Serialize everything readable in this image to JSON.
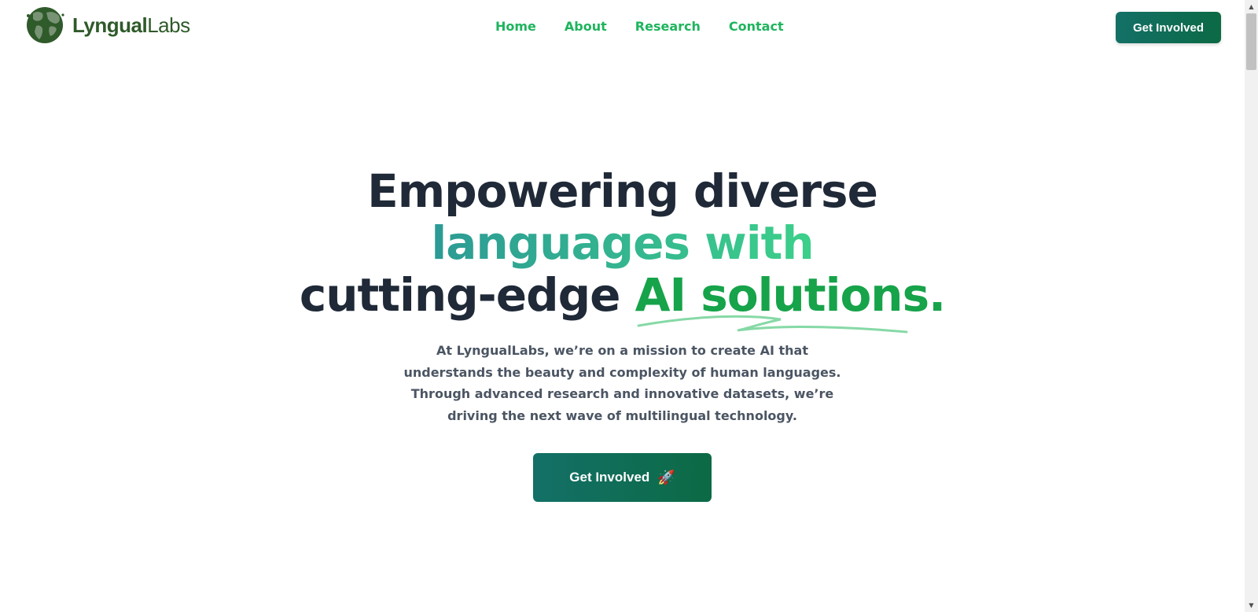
{
  "brand": {
    "name_bold": "Lyngual",
    "name_light": "Labs",
    "icon": "globe-icon"
  },
  "nav": {
    "items": [
      {
        "label": "Home"
      },
      {
        "label": "About"
      },
      {
        "label": "Research"
      },
      {
        "label": "Contact"
      }
    ]
  },
  "header": {
    "cta_label": "Get Involved"
  },
  "hero": {
    "line1": "Empowering diverse",
    "line2": "languages with",
    "line3_a": "cutting-edge ",
    "line3_b": "AI solutions.",
    "description": "At LyngualLabs, we’re on a mission to create AI that understands the beauty and complexity of human languages. Through advanced research and innovative datasets, we’re driving the next wave of multilingual technology.",
    "cta_label": "Get Involved",
    "cta_icon": "rocket-icon"
  },
  "colors": {
    "accent": "#1fb45e",
    "button": "#0c6a45",
    "heading": "#1f2937",
    "text": "#4b5563"
  }
}
